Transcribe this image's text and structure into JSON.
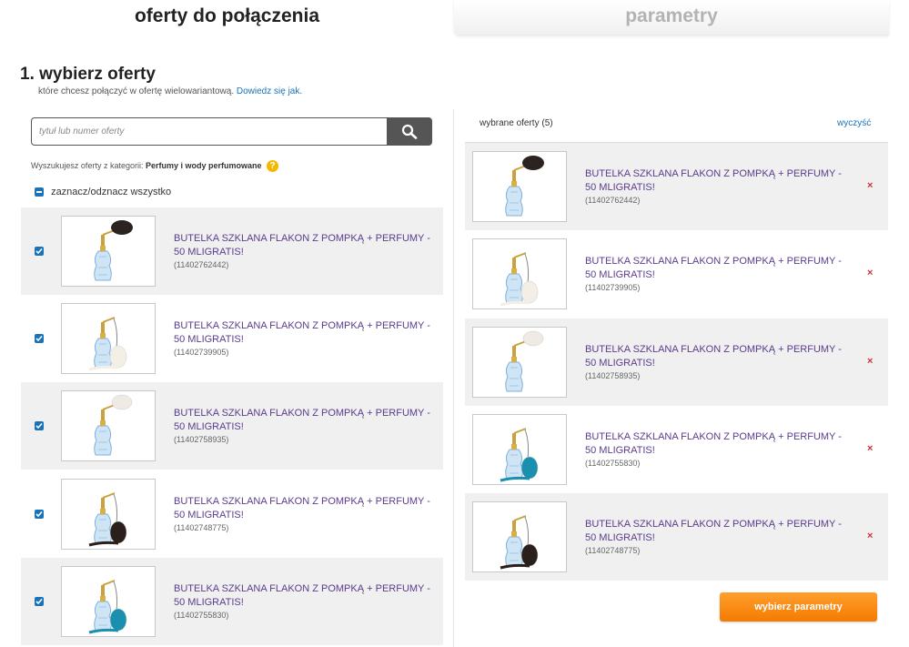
{
  "tabs": {
    "active": "oferty do połączenia",
    "inactive": "parametry"
  },
  "step": {
    "title": "1. wybierz oferty",
    "subtitle": "które chcesz połączyć w ofertę wielowariantową.",
    "learn_more": "Dowiedz się jak."
  },
  "search": {
    "placeholder": "tytuł lub numer oferty",
    "icon": "search-icon"
  },
  "category": {
    "prefix": "Wyszukujesz oferty z kategorii:",
    "name": "Perfumy i wody perfumowane"
  },
  "toggle_all_label": "zaznacz/odznacz wszystko",
  "offers": [
    {
      "title": "BUTELKA SZKLANA FLAKON Z POMPKĄ + PERFUMY - 50 MLIGRATIS!",
      "id": "(11402762442)",
      "checked": true,
      "bulb": "#2b2320",
      "style": "dark"
    },
    {
      "title": "BUTELKA SZKLANA FLAKON Z POMPKĄ + PERFUMY - 50 MLIGRATIS!",
      "id": "(11402739905)",
      "checked": true,
      "bulb": "#f4efe6",
      "style": "tassel"
    },
    {
      "title": "BUTELKA SZKLANA FLAKON Z POMPKĄ + PERFUMY - 50 MLIGRATIS!",
      "id": "(11402758935)",
      "checked": true,
      "bulb": "#efeae4",
      "style": "short"
    },
    {
      "title": "BUTELKA SZKLANA FLAKON Z POMPKĄ + PERFUMY - 50 MLIGRATIS!",
      "id": "(11402748775)",
      "checked": true,
      "bulb": "#2a1f1a",
      "style": "tassel"
    },
    {
      "title": "BUTELKA SZKLANA FLAKON Z POMPKĄ + PERFUMY - 50 MLIGRATIS!",
      "id": "(11402755830)",
      "checked": true,
      "bulb": "#1a8fae",
      "style": "tassel"
    }
  ],
  "selected": {
    "header": "wybrane oferty (5)",
    "clear": "wyczyść",
    "remove_icon": "×",
    "items": [
      {
        "title": "BUTELKA SZKLANA FLAKON Z POMPKĄ + PERFUMY - 50 MLIGRATIS!",
        "id": "(11402762442)",
        "bulb": "#2b2320",
        "style": "dark"
      },
      {
        "title": "BUTELKA SZKLANA FLAKON Z POMPKĄ + PERFUMY - 50 MLIGRATIS!",
        "id": "(11402739905)",
        "bulb": "#f4efe6",
        "style": "tassel"
      },
      {
        "title": "BUTELKA SZKLANA FLAKON Z POMPKĄ + PERFUMY - 50 MLIGRATIS!",
        "id": "(11402758935)",
        "bulb": "#efeae4",
        "style": "short"
      },
      {
        "title": "BUTELKA SZKLANA FLAKON Z POMPKĄ + PERFUMY - 50 MLIGRATIS!",
        "id": "(11402755830)",
        "bulb": "#1a8fae",
        "style": "tassel"
      },
      {
        "title": "BUTELKA SZKLANA FLAKON Z POMPKĄ + PERFUMY - 50 MLIGRATIS!",
        "id": "(11402748775)",
        "bulb": "#2a1f1a",
        "style": "tassel"
      }
    ]
  },
  "next_button": "wybierz parametry",
  "colors": {
    "accent_blue": "#1a73b8",
    "title_purple": "#5b3c8c",
    "orange": "#f57a00",
    "remove_red": "#d23030"
  }
}
